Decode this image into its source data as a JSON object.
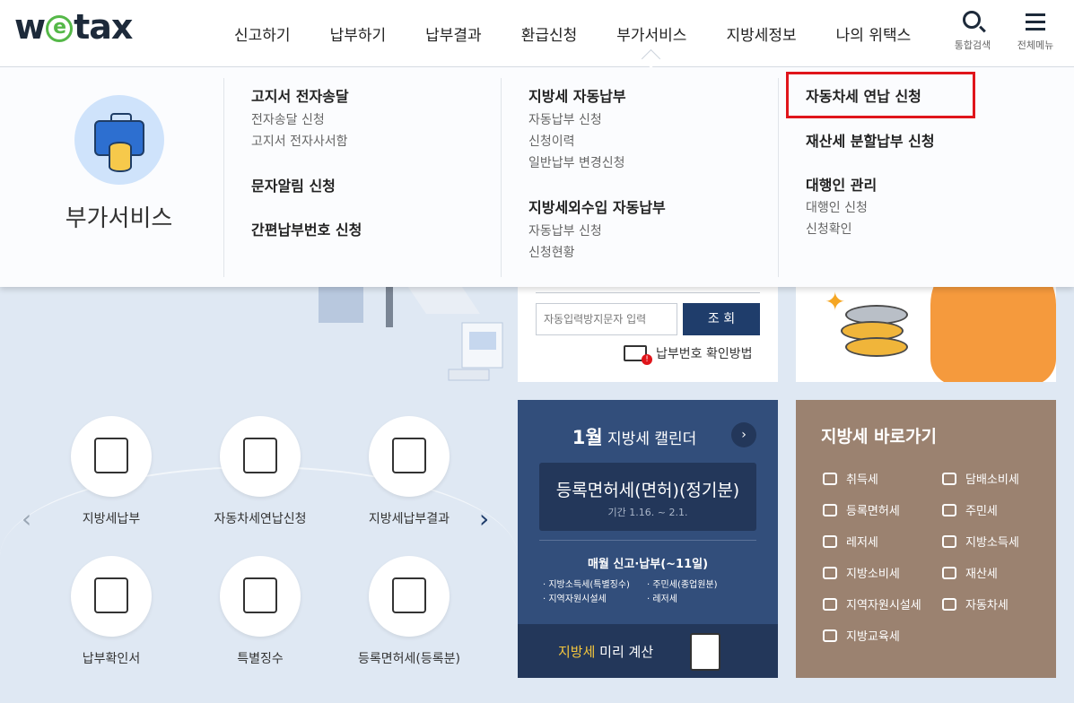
{
  "logo": {
    "pre": "w",
    "e": "e",
    "post": "tax"
  },
  "nav": [
    "신고하기",
    "납부하기",
    "납부결과",
    "환급신청",
    "부가서비스",
    "지방세정보",
    "나의 위택스"
  ],
  "utils": {
    "search": "통합검색",
    "menu": "전체메뉴"
  },
  "mega": {
    "title": "부가서비스",
    "col1": {
      "group1": {
        "head": "고지서 전자송달",
        "subs": [
          "전자송달 신청",
          "고지서 전자사서함"
        ]
      },
      "head2": "문자알림 신청",
      "head3": "간편납부번호 신청"
    },
    "col2": {
      "group1": {
        "head": "지방세 자동납부",
        "subs": [
          "자동납부 신청",
          "신청이력",
          "일반납부 변경신청"
        ]
      },
      "group2": {
        "head": "지방세외수입 자동납부",
        "subs": [
          "자동납부 신청",
          "신청현황"
        ]
      }
    },
    "col3": {
      "head1": "자동차세 연납 신청",
      "head2": "재산세 분할납부 신청",
      "group3": {
        "head": "대행인 관리",
        "subs": [
          "대행인 신청",
          "신청확인"
        ]
      }
    }
  },
  "search_panel": {
    "placeholder": "자동입력방지문자 입력",
    "button": "조 회",
    "help": "납부번호 확인방법"
  },
  "calendar": {
    "month": "1월",
    "title": "지방세 캘린더",
    "arrow": "›",
    "tax": "등록면허세(면허)(정기분)",
    "period": "기간 1.16. ~ 2.1.",
    "monthly": "매월 신고·납부(~11일)",
    "list_left": [
      "· 지방소득세(특별징수)",
      "· 지역자원시설세"
    ],
    "list_right": [
      "· 주민세(종업원분)",
      "· 레저세"
    ],
    "calc_hl": "지방세",
    "calc_rest": " 미리 계산"
  },
  "shortcuts": {
    "title": "지방세 바로가기",
    "left": [
      "취득세",
      "등록면허세",
      "레저세",
      "지방소비세",
      "지역자원시설세",
      "지방교육세"
    ],
    "right": [
      "담배소비세",
      "주민세",
      "지방소득세",
      "재산세",
      "자동차세"
    ]
  },
  "services": [
    "지방세납부",
    "자동차세연납신청",
    "지방세납부결과",
    "납부확인서",
    "특별징수",
    "등록면허세(등록분)"
  ],
  "arrows": {
    "left": "‹",
    "right": "›"
  }
}
